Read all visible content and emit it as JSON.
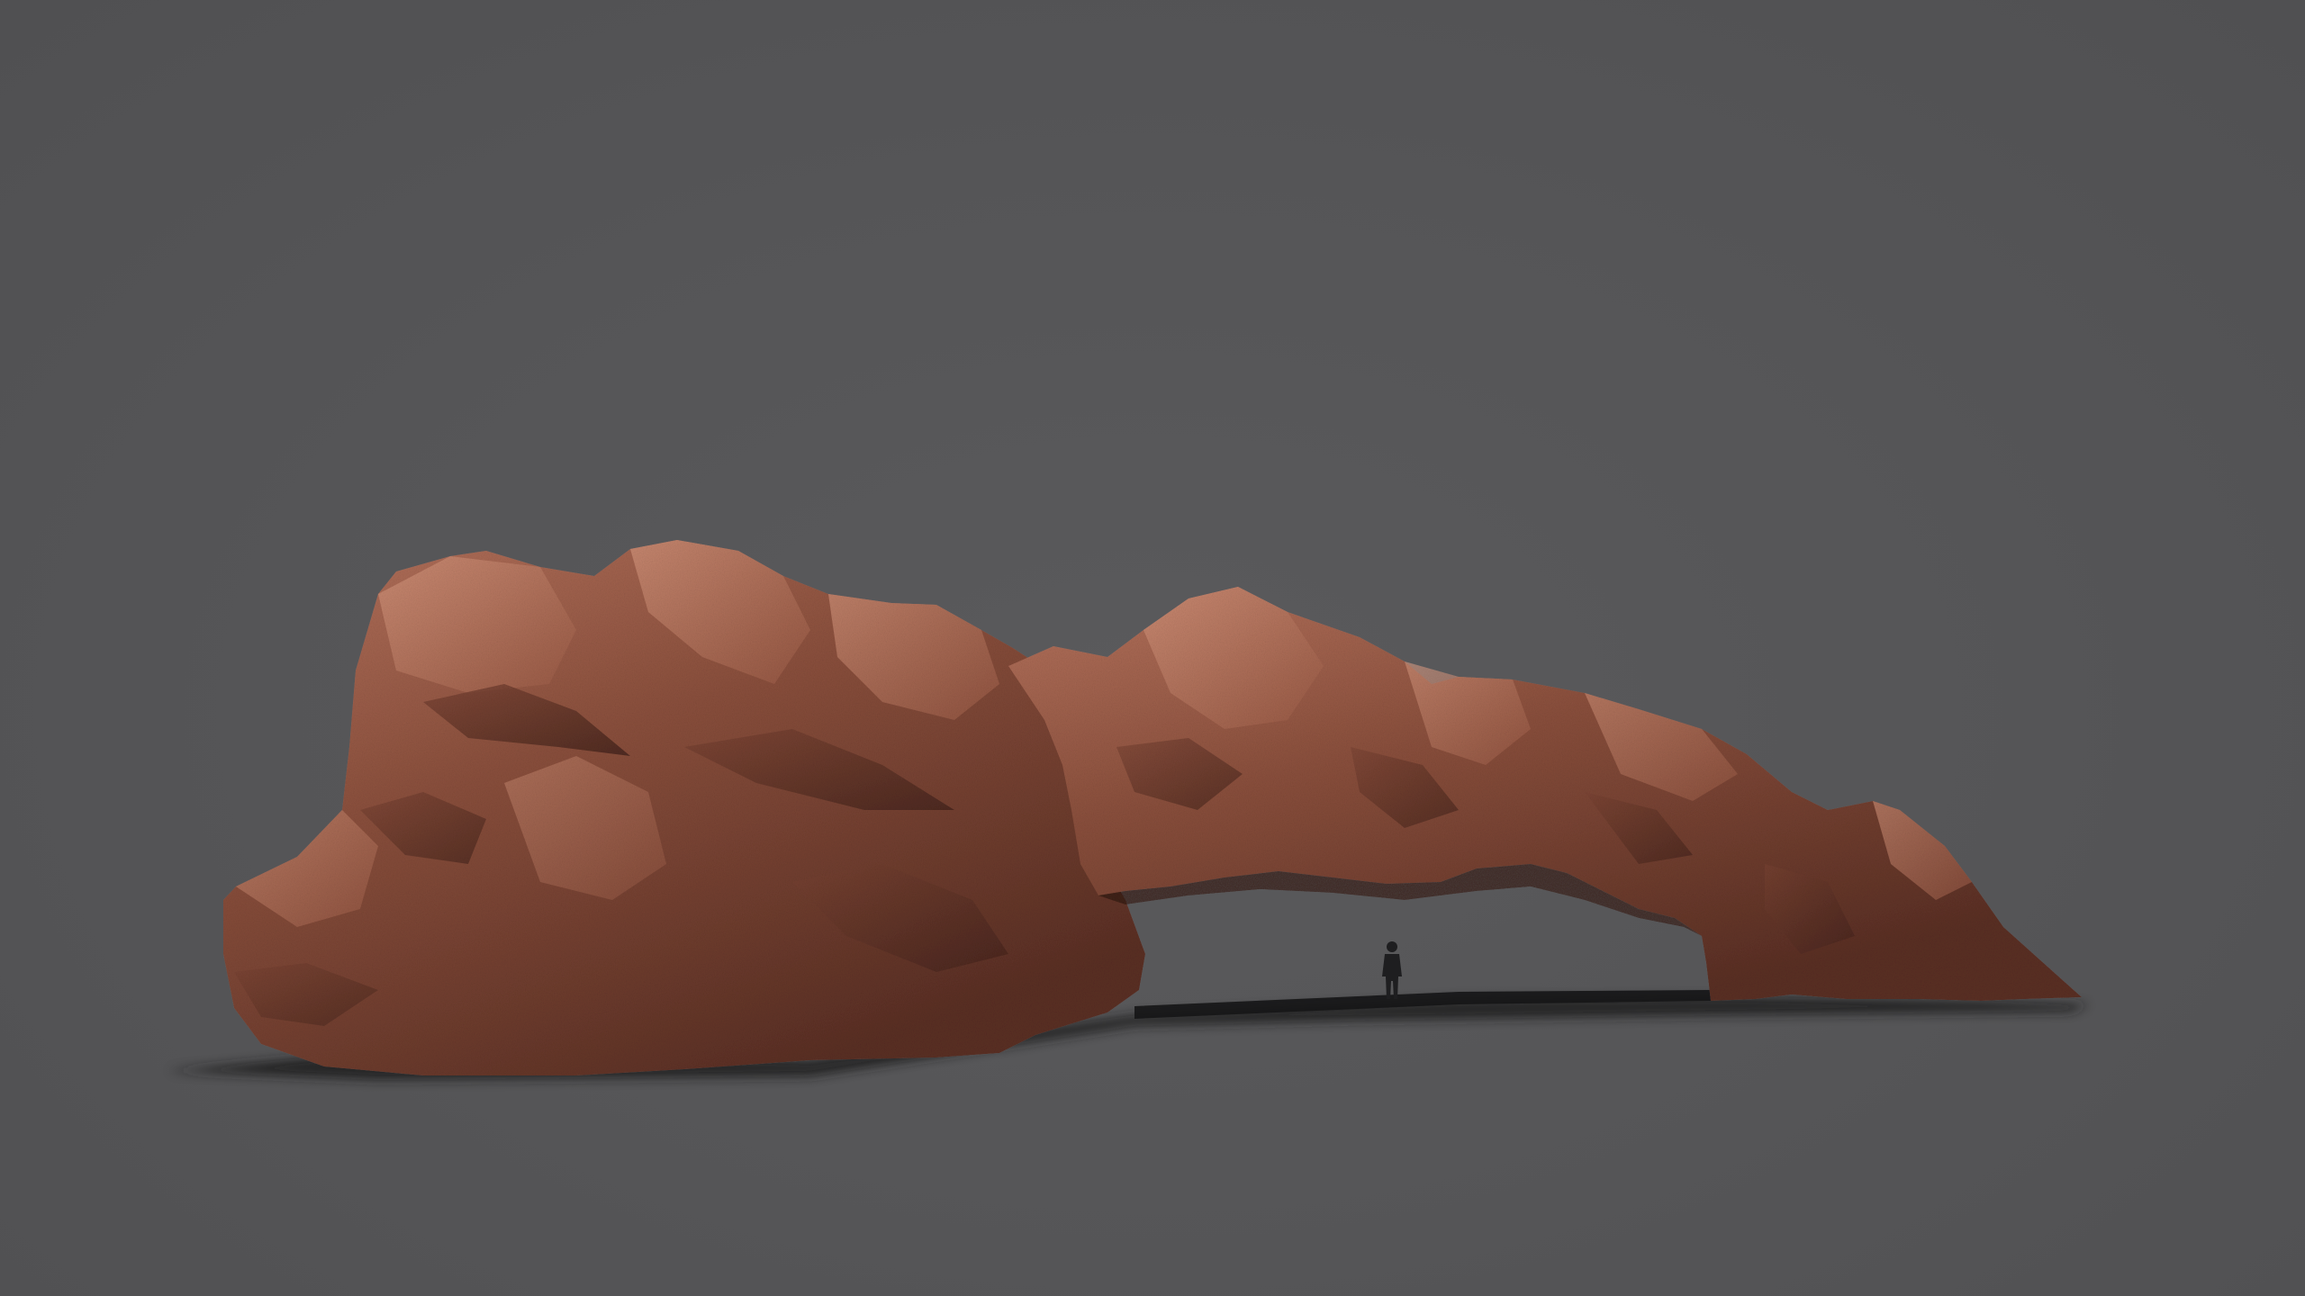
{
  "scene": {
    "subject": "rock-arch-3d-render",
    "background_color": "#555557",
    "rock_base_color": "#8a4f3c",
    "rock_highlight_color": "#c98a72",
    "rock_shadow_color": "#3e2019",
    "ground_shadow_color": "#1b1b1c",
    "figure_color": "#1e1e20"
  }
}
